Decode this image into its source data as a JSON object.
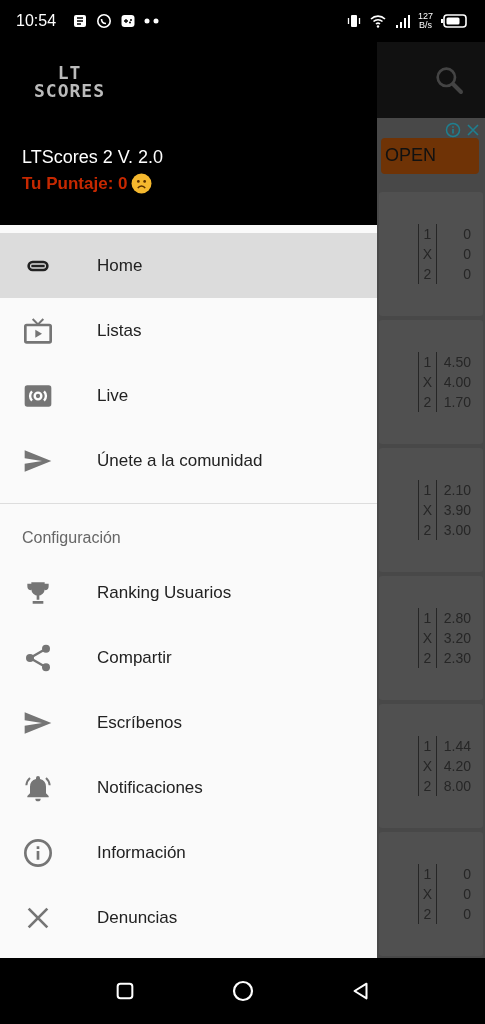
{
  "status_bar": {
    "time": "10:54",
    "speed": "127",
    "speed_unit": "B/s"
  },
  "drawer": {
    "logo_lines": [
      "LT",
      "SCORES"
    ],
    "app_version": "LTScores 2 V. 2.0",
    "score": "Tu Puntaje: 0",
    "main_items": [
      {
        "label": "Home",
        "kind": "link",
        "selected": true
      },
      {
        "label": "Listas",
        "kind": "tv",
        "selected": false
      },
      {
        "label": "Live",
        "kind": "live",
        "selected": false
      },
      {
        "label": "Únete a la comunidad",
        "kind": "send",
        "selected": false
      }
    ],
    "section_title": "Configuración",
    "settings_items": [
      {
        "label": "Ranking Usuarios",
        "kind": "trophy",
        "selected": false
      },
      {
        "label": "Compartir",
        "kind": "share",
        "selected": false
      },
      {
        "label": "Escríbenos",
        "kind": "send",
        "selected": false
      },
      {
        "label": "Notificaciones",
        "kind": "bell",
        "selected": false
      },
      {
        "label": "Información",
        "kind": "info",
        "selected": false
      },
      {
        "label": "Denuncias",
        "kind": "close",
        "selected": false
      }
    ]
  },
  "background": {
    "ad_button": "OPEN",
    "matches": [
      {
        "odds": [
          {
            "label": "1",
            "value": "0"
          },
          {
            "label": "X",
            "value": "0"
          },
          {
            "label": "2",
            "value": "0"
          }
        ]
      },
      {
        "odds": [
          {
            "label": "1",
            "value": "4.50"
          },
          {
            "label": "X",
            "value": "4.00"
          },
          {
            "label": "2",
            "value": "1.70"
          }
        ]
      },
      {
        "odds": [
          {
            "label": "1",
            "value": "2.10"
          },
          {
            "label": "X",
            "value": "3.90"
          },
          {
            "label": "2",
            "value": "3.00"
          }
        ]
      },
      {
        "odds": [
          {
            "label": "1",
            "value": "2.80"
          },
          {
            "label": "X",
            "value": "3.20"
          },
          {
            "label": "2",
            "value": "2.30"
          }
        ]
      },
      {
        "odds": [
          {
            "label": "1",
            "value": "1.44"
          },
          {
            "label": "X",
            "value": "4.20"
          },
          {
            "label": "2",
            "value": "8.00"
          }
        ]
      },
      {
        "odds": [
          {
            "label": "1",
            "value": "0"
          },
          {
            "label": "X",
            "value": "0"
          },
          {
            "label": "2",
            "value": "0"
          }
        ]
      }
    ]
  }
}
